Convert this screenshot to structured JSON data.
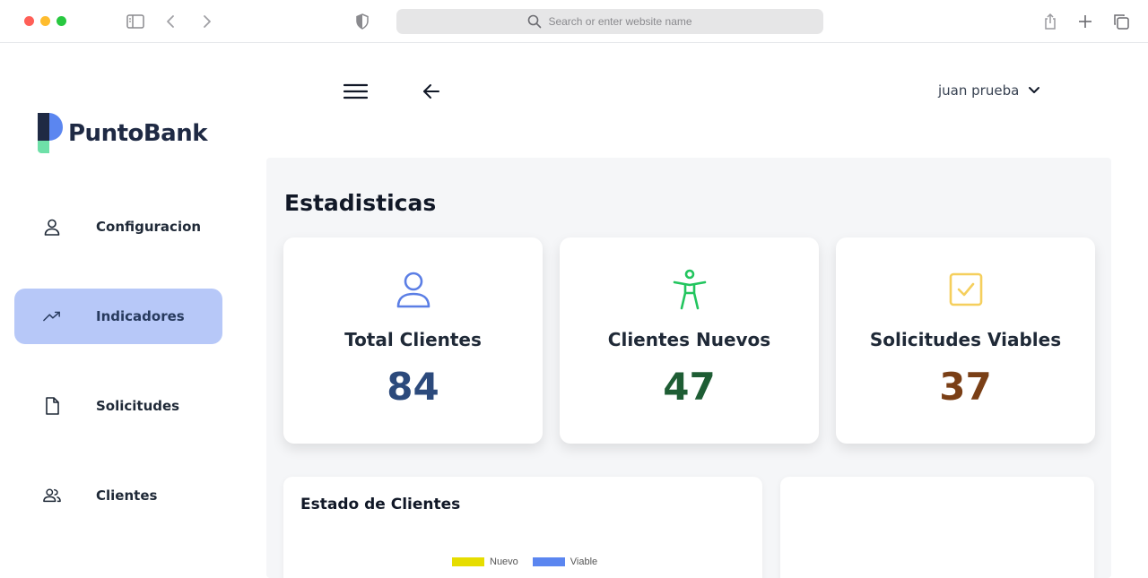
{
  "browser": {
    "url_placeholder": "Search or enter website name"
  },
  "brand": {
    "name": "PuntoBank"
  },
  "sidebar": {
    "items": [
      {
        "label": "Configuracion",
        "icon": "user-icon",
        "active": false
      },
      {
        "label": "Indicadores",
        "icon": "trending-up-icon",
        "active": true
      },
      {
        "label": "Solicitudes",
        "icon": "file-icon",
        "active": false
      },
      {
        "label": "Clientes",
        "icon": "users-icon",
        "active": false
      }
    ]
  },
  "header": {
    "user_name": "juan prueba"
  },
  "main": {
    "title": "Estadisticas",
    "stats": [
      {
        "label": "Total Clientes",
        "value": "84",
        "icon": "user-outline-icon",
        "icon_color": "#5b7ee5",
        "value_color": "#2c4a7c"
      },
      {
        "label": "Clientes Nuevos",
        "value": "47",
        "icon": "accessibility-icon",
        "icon_color": "#22c55e",
        "value_color": "#1e5d34"
      },
      {
        "label": "Solicitudes Viables",
        "value": "37",
        "icon": "checkbox-icon",
        "icon_color": "#f5cf5d",
        "value_color": "#7a3f16"
      }
    ],
    "chart_panel": {
      "title": "Estado de Clientes"
    }
  },
  "chart_data": {
    "type": "bar",
    "title": "Estado de Clientes",
    "series": [
      {
        "name": "Nuevo",
        "color": "#e6dd00",
        "values": []
      },
      {
        "name": "Viable",
        "color": "#5b86f0",
        "values": []
      }
    ],
    "legend": "top-center"
  }
}
